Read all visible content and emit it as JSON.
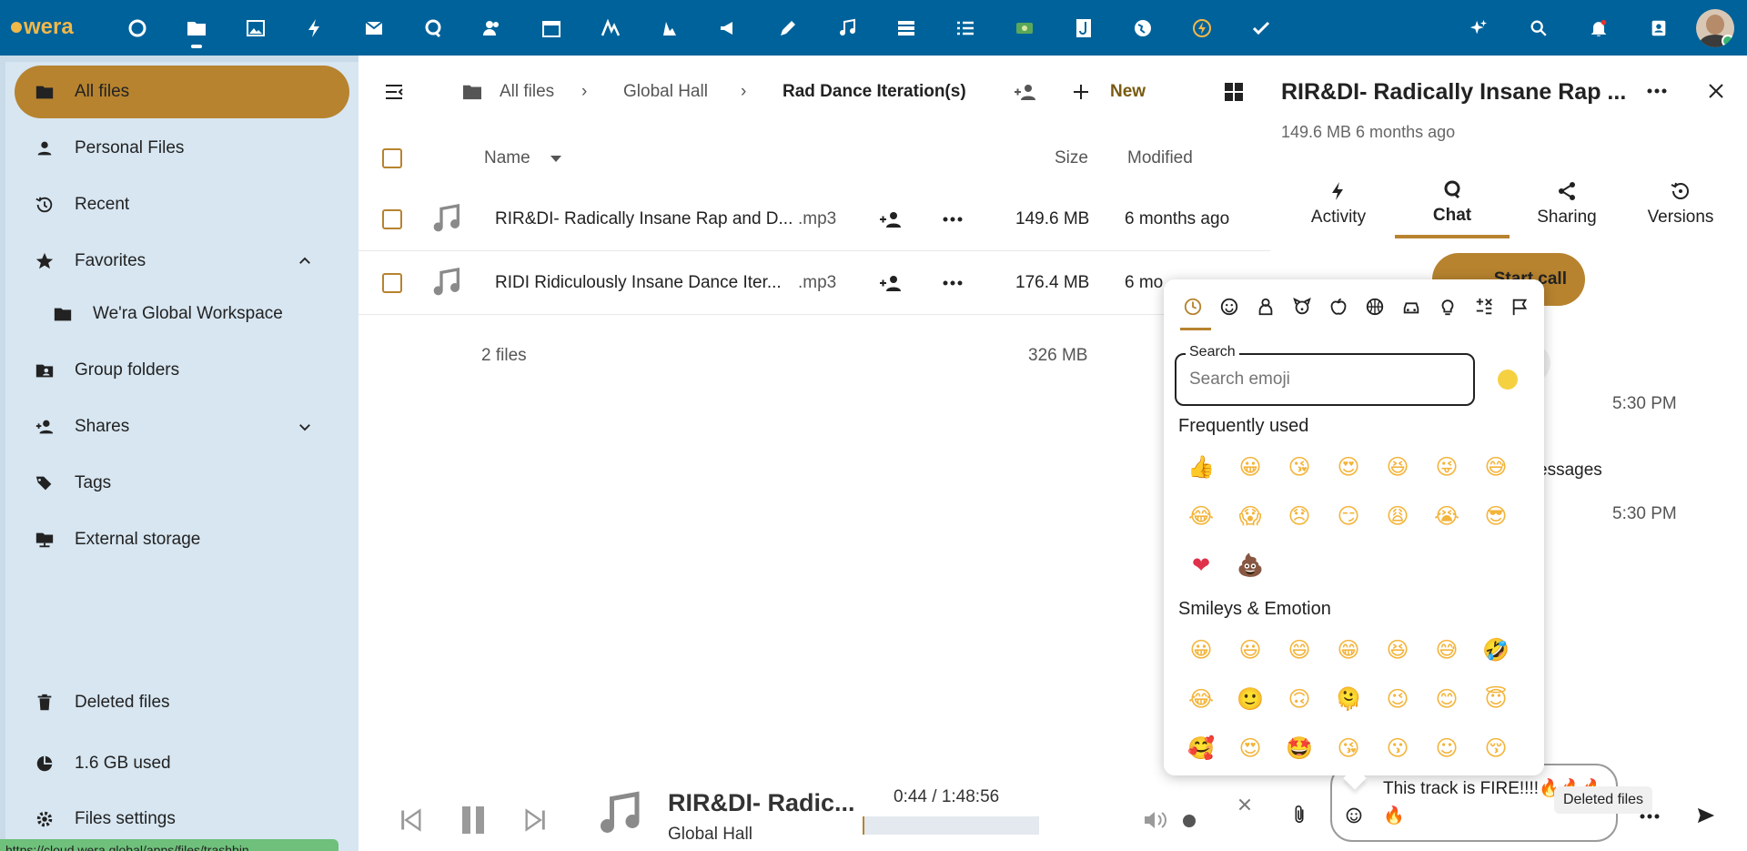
{
  "app": {
    "logo_text": "wera",
    "accent": "#b7832f",
    "header_bg": "#00629a"
  },
  "header": {
    "apps": [
      "dashboard-icon",
      "files-icon",
      "photos-icon",
      "activity-icon",
      "mail-icon",
      "talk-icon",
      "contacts-icon",
      "calendar-icon",
      "analytics-icon",
      "tasks-icon",
      "announcements-icon",
      "notes-icon",
      "music-icon",
      "deck-icon",
      "list-icon",
      "cospend-icon",
      "jdoc-icon",
      "maps-icon",
      "flow-icon",
      "checkmark-icon"
    ],
    "right": [
      "assistant-icon",
      "search-icon",
      "notifications-icon",
      "contacts-menu-icon"
    ]
  },
  "sidebar": {
    "items": [
      {
        "label": "All files",
        "icon": "folder-icon"
      },
      {
        "label": "Personal Files",
        "icon": "person-icon"
      },
      {
        "label": "Recent",
        "icon": "history-icon"
      },
      {
        "label": "Favorites",
        "icon": "star-icon"
      },
      {
        "label": "We'ra Global Workspace",
        "icon": "folder-icon"
      },
      {
        "label": "Group folders",
        "icon": "group-folder-icon"
      },
      {
        "label": "Shares",
        "icon": "share-person-icon"
      },
      {
        "label": "Tags",
        "icon": "tags-icon"
      },
      {
        "label": "External storage",
        "icon": "external-storage-icon"
      }
    ],
    "deleted": "Deleted files",
    "quota": "1.6 GB used",
    "settings": "Files settings",
    "status_url": "https://cloud.wera.global/apps/files/trashbin"
  },
  "breadcrumb": {
    "root": "All files",
    "mid": "Global Hall",
    "current": "Rad Dance Iteration(s)",
    "new_label": "New"
  },
  "files": {
    "columns": {
      "name": "Name",
      "size": "Size",
      "modified": "Modified"
    },
    "rows": [
      {
        "name": "RIR&DI- Radically Insane Rap and D...",
        "ext": ".mp3",
        "size": "149.6 MB",
        "modified": "6 months ago"
      },
      {
        "name": "RIDI Ridiculously Insane Dance Iter...",
        "ext": ".mp3",
        "size": "176.4 MB",
        "modified": "6 mo"
      }
    ],
    "summary": {
      "count": "2 files",
      "size": "326 MB"
    }
  },
  "player": {
    "title": "RIR&DI- Radic...",
    "subtitle": "Global Hall",
    "time": "0:44 / 1:48:56",
    "progress": 0.007
  },
  "details": {
    "title": "RIR&DI- Radically Insane Rap ...",
    "meta": "149.6 MB 6 months ago",
    "tabs": [
      "Activity",
      "Chat",
      "Sharing",
      "Versions"
    ],
    "start_call": "Start call",
    "time1": "5:30 PM",
    "messages_text": "essages",
    "time2": "5:30 PM",
    "message_text": "This track is FIRE!!!!🔥🔥🔥",
    "draft_text": "🔥",
    "tooltip": "Deleted files"
  },
  "emoji_picker": {
    "categories": [
      "recent-icon",
      "smiley-icon",
      "person-icon",
      "animal-icon",
      "food-icon",
      "activity-ball-icon",
      "car-icon",
      "lightbulb-icon",
      "symbols-icon",
      "flags-icon"
    ],
    "search_label": "Search",
    "search_placeholder": "Search emoji",
    "frequent_title": "Frequently used",
    "frequent": [
      "👍",
      "😀",
      "😘",
      "😍",
      "😆",
      "😜",
      "😅",
      "😂",
      "😱",
      "😞",
      "😏",
      "😩",
      "😭",
      "😎",
      "❤",
      "💩"
    ],
    "smileys_title": "Smileys & Emotion",
    "smileys": [
      "😀",
      "😃",
      "😄",
      "😁",
      "😆",
      "😅",
      "🤣",
      "😂",
      "🙂",
      "🙃",
      "🫠",
      "😉",
      "😊",
      "😇",
      "🥰",
      "😍",
      "🤩",
      "😘",
      "😗",
      "☺",
      "😚"
    ]
  }
}
